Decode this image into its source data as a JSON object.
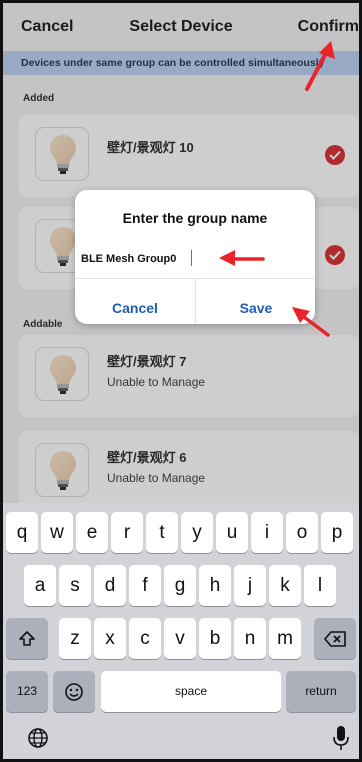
{
  "nav": {
    "cancel": "Cancel",
    "title": "Select Device",
    "confirm": "Confirm"
  },
  "banner": "Devices under same group can be controlled simultaneously",
  "sections": {
    "added": "Added",
    "addable": "Addable"
  },
  "devices_added": [
    {
      "name": "壁灯/景观灯 10",
      "selected": true
    },
    {
      "name": "",
      "selected": true
    }
  ],
  "devices_addable": [
    {
      "name": "壁灯/景观灯 7",
      "status": "Unable to Manage"
    },
    {
      "name": "壁灯/景观灯 6",
      "status": "Unable to Manage"
    }
  ],
  "dialog": {
    "title": "Enter the group name",
    "input_value": "BLE Mesh Group0",
    "cancel": "Cancel",
    "save": "Save"
  },
  "keyboard": {
    "row1": [
      "q",
      "w",
      "e",
      "r",
      "t",
      "y",
      "u",
      "i",
      "o",
      "p"
    ],
    "row2": [
      "a",
      "s",
      "d",
      "f",
      "g",
      "h",
      "j",
      "k",
      "l"
    ],
    "row3": [
      "z",
      "x",
      "c",
      "v",
      "b",
      "n",
      "m"
    ],
    "numbers": "123",
    "space": "space",
    "return": "return"
  },
  "colors": {
    "accent": "#1f5db3",
    "check": "#d8262a",
    "annotation_arrow": "#e8242a",
    "banner": "#b9cff2"
  }
}
